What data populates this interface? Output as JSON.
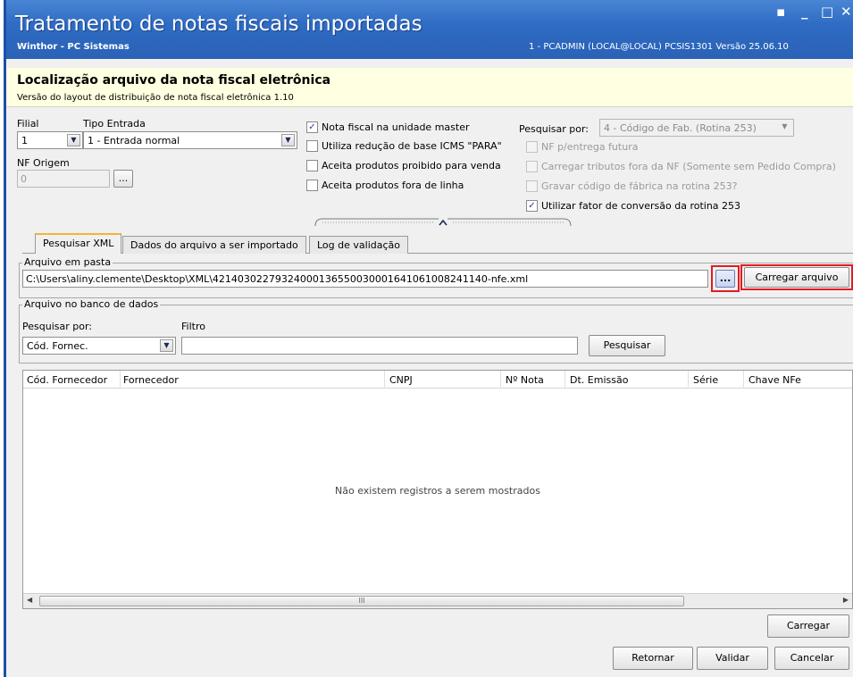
{
  "window": {
    "title": "Tratamento de notas fiscais importadas",
    "subtitle": "Winthor - PC Sistemas",
    "info": "1 - PCADMIN (LOCAL@LOCAL)   PCSIS1301   Versão 25.06.10",
    "controls": {
      "restore": "▪",
      "minimize": "_",
      "maximize": "□",
      "close": "✕"
    }
  },
  "header": {
    "title": "Localização arquivo da nota fiscal eletrônica",
    "subtitle": "Versão do layout de distribuição de nota fiscal eletrônica 1.10"
  },
  "filters": {
    "filial_label": "Filial",
    "filial_value": "1",
    "tipo_entrada_label": "Tipo Entrada",
    "tipo_entrada_value": "1 - Entrada normal",
    "nf_origem_label": "NF Origem",
    "nf_origem_value": "0",
    "nf_origem_button": "...",
    "checks": [
      {
        "label": "Nota fiscal na unidade master",
        "checked": true
      },
      {
        "label": "Utiliza redução de base ICMS \"PARA\"",
        "checked": false
      },
      {
        "label": "Aceita produtos proibido para venda",
        "checked": false
      },
      {
        "label": "Aceita produtos fora de linha",
        "checked": false
      }
    ],
    "pesquisar_por_label": "Pesquisar por:",
    "pesquisar_por_value": "4 - Código de Fab. (Rotina 253)",
    "right_checks": [
      {
        "label": "NF p/entrega futura",
        "checked": false,
        "disabled": true
      },
      {
        "label": "Carregar tributos fora da NF (Somente sem Pedido Compra)",
        "checked": false,
        "disabled": true
      },
      {
        "label": "Gravar código de fábrica na rotina 253?",
        "checked": false,
        "disabled": true
      },
      {
        "label": "Utilizar fator de conversão da rotina 253",
        "checked": true,
        "disabled": false
      }
    ]
  },
  "tabs": [
    {
      "label": "Pesquisar XML",
      "active": true
    },
    {
      "label": "Dados do arquivo a ser importado",
      "active": false
    },
    {
      "label": "Log de validação",
      "active": false
    }
  ],
  "arquivo_pasta": {
    "legend": "Arquivo em pasta",
    "path": "C:\\Users\\aliny.clemente\\Desktop\\XML\\42140302279324000136550030001641061008241140-nfe.xml",
    "browse_label": "...",
    "carregar_label": "Carregar arquivo"
  },
  "arquivo_banco": {
    "legend": "Arquivo no banco de dados",
    "pesquisar_por_label": "Pesquisar por:",
    "pesquisar_por_value": "Cód. Fornec.",
    "filtro_label": "Filtro",
    "filtro_value": "",
    "pesquisar_button": "Pesquisar"
  },
  "grid": {
    "columns": [
      "Cód. Fornecedor",
      "Fornecedor",
      "CNPJ",
      "Nº Nota",
      "Dt. Emissão",
      "Série",
      "Chave NFe"
    ],
    "empty_message": "Não existem registros a serem mostrados",
    "scroll_grip": "III"
  },
  "footer": {
    "carregar": "Carregar",
    "retornar": "Retornar",
    "validar": "Validar",
    "cancelar": "Cancelar"
  },
  "colors": {
    "titlebar": "#2f6cc4",
    "header_bg": "#ffffe1",
    "highlight": "#e01c24",
    "tab_accent": "#f3b338"
  }
}
